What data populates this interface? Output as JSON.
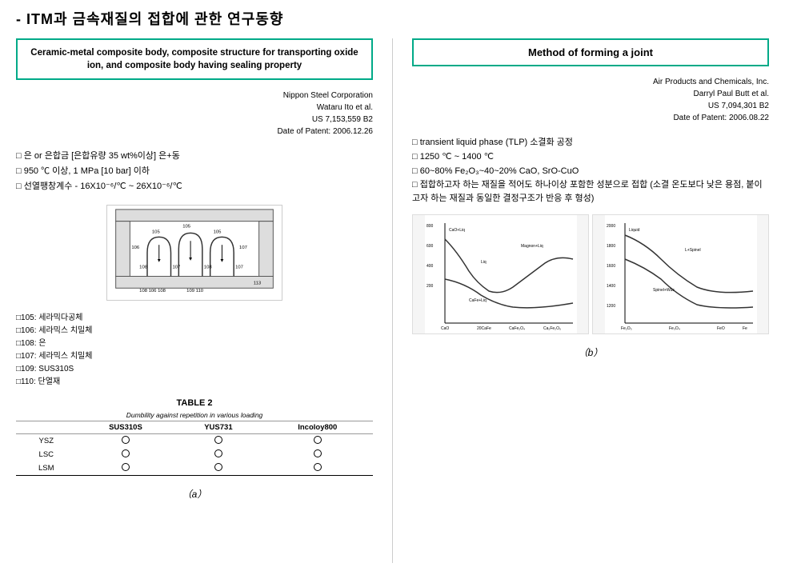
{
  "header": {
    "title": "- ITM과 금속재질의 접합에 관한 연구동향"
  },
  "left": {
    "box_title": "Ceramic-metal composite body, composite structure for transporting oxide ion, and composite body having sealing property",
    "patent_info": {
      "company": "Nippon Steel Corporation",
      "inventors": "Wataru Ito et al.",
      "patent_num": "US 7,153,559 B2",
      "date_label": "Date of Patent: 2006.12.26"
    },
    "bullets": [
      "□ 은 or 은합금 [은합유량 35 wt%이상] 은+동",
      "□ 950 ℃ 이상, 1 MPa [10 bar] 이하",
      "□ 선열팽창계수 - 16X10⁻⁶/℃ ~ 26X10⁻⁶/℃"
    ],
    "legend": [
      "□105: 세라믹다공체",
      "□106: 세라믹스 치밀체",
      "□108: 은",
      "□107: 세라믹스 치밀체",
      "□109: SUS310S",
      "□110: 단열재"
    ],
    "table": {
      "title": "TABLE 2",
      "subtitle": "Dumbility against repetition in various loading",
      "headers": [
        "SUS310S",
        "YUS731",
        "Incoloy800"
      ],
      "rows": [
        {
          "label": "YSZ",
          "vals": [
            "○",
            "○",
            "○"
          ]
        },
        {
          "label": "LSC",
          "vals": [
            "○",
            "○",
            "○"
          ]
        },
        {
          "label": "LSM",
          "vals": [
            "○",
            "○",
            "○"
          ]
        }
      ]
    },
    "label": "（a）"
  },
  "right": {
    "box_title": "Method of forming a joint",
    "patent_info": {
      "company": "Air Products and Chemicals, Inc.",
      "inventors": "Darryl Paul Butt et al.",
      "patent_num": "US 7,094,301 B2",
      "date_label": "Date of Patent: 2006.08.22"
    },
    "bullets": [
      "□ transient liquid phase (TLP) 소결화 공정",
      "□ 1250 ℃ ~ 1400 ℃",
      "□ 60~80% Fe₂O₃~40~20% CaO, SrO-CuO",
      "□ 접합하고자 하는 재질을 적어도 하나이상 포함한 성분으로 접합 (소결 온도보다 낮은 용점, 붙이고자 하는 재질과 동일한 결정구조가 반응 후 형성)"
    ],
    "label": "（b）"
  }
}
